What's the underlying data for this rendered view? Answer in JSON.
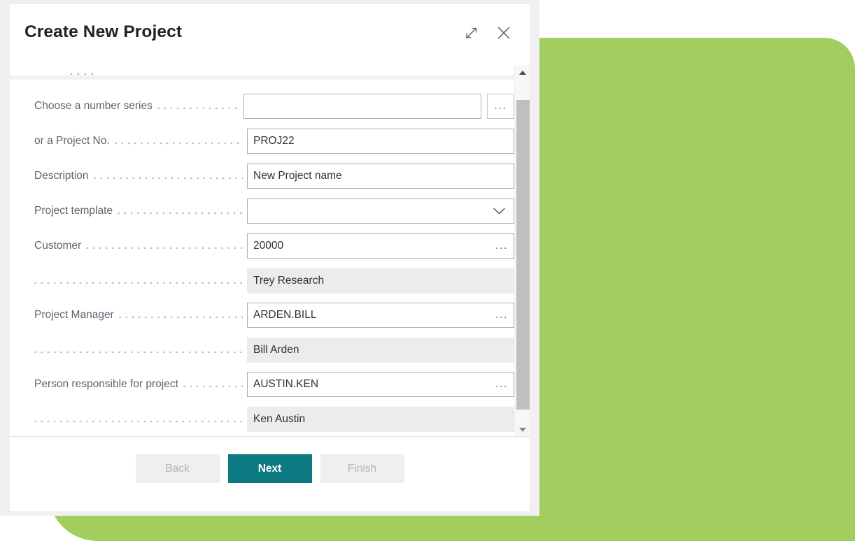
{
  "backdrop": {
    "color": "#a3ce5f"
  },
  "dialog": {
    "title": "Create New Project",
    "expand_icon": "expand-diagonal-icon",
    "close_icon": "close-x-icon"
  },
  "form": {
    "rows": [
      {
        "label": "Choose a number series",
        "value": "",
        "placeholder": "",
        "kind": "input-with-external-ellipsis",
        "assist": "..."
      },
      {
        "label": "or a Project No.",
        "value": "PROJ22",
        "placeholder": "",
        "kind": "input"
      },
      {
        "label": "Description",
        "value": "New Project name",
        "placeholder": "",
        "kind": "input"
      },
      {
        "label": "Project template",
        "value": "",
        "placeholder": "",
        "kind": "dropdown",
        "assist": "chevron-down-icon"
      },
      {
        "label": "Customer",
        "value": "20000",
        "placeholder": "",
        "kind": "lookup",
        "assist": "..."
      },
      {
        "label": "",
        "value": "Trey Research",
        "kind": "readonly"
      },
      {
        "label": "Project Manager",
        "value": "ARDEN.BILL",
        "placeholder": "",
        "kind": "lookup",
        "assist": "..."
      },
      {
        "label": "",
        "value": "Bill Arden",
        "kind": "readonly"
      },
      {
        "label": "Person responsible for project",
        "value": "AUSTIN.KEN",
        "placeholder": "",
        "kind": "lookup",
        "assist": "..."
      },
      {
        "label": "",
        "value": "Ken Austin",
        "kind": "readonly"
      }
    ]
  },
  "scrollbar": {
    "up_icon": "scroll-up-arrow-icon",
    "down_icon": "scroll-down-arrow-icon"
  },
  "footer": {
    "back_label": "Back",
    "next_label": "Next",
    "finish_label": "Finish",
    "primary_color": "#0c7a80"
  }
}
